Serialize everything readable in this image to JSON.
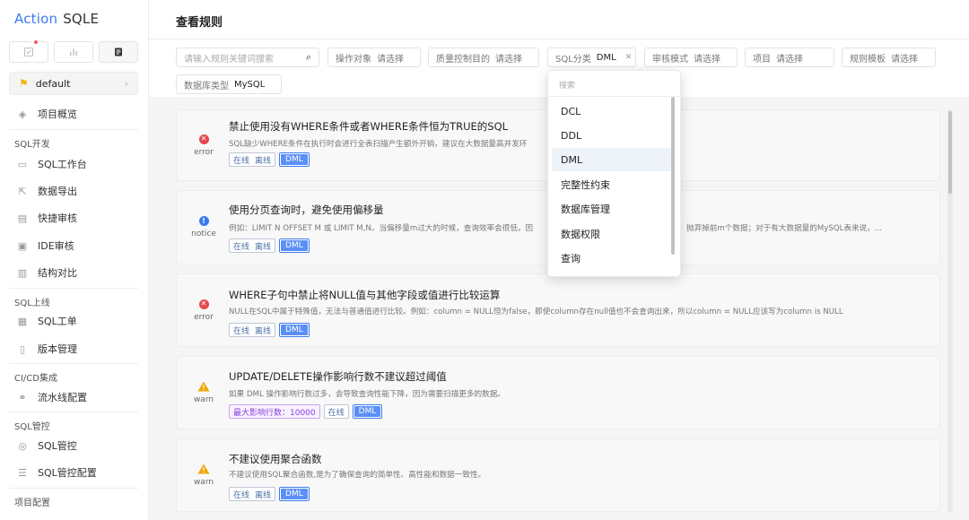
{
  "app": {
    "brand": "Action",
    "name": "SQLE"
  },
  "sidebar": {
    "project": "default",
    "overview": "项目概览",
    "groups": [
      {
        "title": "SQL开发",
        "items": [
          "SQL工作台",
          "数据导出",
          "快捷审核",
          "IDE审核",
          "结构对比"
        ]
      },
      {
        "title": "SQL上线",
        "items": [
          "SQL工单",
          "版本管理"
        ]
      },
      {
        "title": "CI/CD集成",
        "items": [
          "流水线配置"
        ]
      },
      {
        "title": "SQL管控",
        "items": [
          "SQL管控",
          "SQL管控配置"
        ]
      },
      {
        "title": "项目配置",
        "items": []
      }
    ]
  },
  "page": {
    "title": "查看规则"
  },
  "filters": {
    "search_placeholder": "请输入规则关键词搜索",
    "op_object": {
      "label": "操作对象",
      "placeholder": "请选择"
    },
    "quality": {
      "label": "质量控制目的",
      "placeholder": "请选择"
    },
    "sql_type": {
      "label": "SQL分类",
      "value": "DML"
    },
    "audit_mode": {
      "label": "审核模式",
      "placeholder": "请选择"
    },
    "project": {
      "label": "项目",
      "placeholder": "请选择"
    },
    "template": {
      "label": "规则模板",
      "placeholder": "请选择"
    },
    "db_type": {
      "label": "数据库类型",
      "value": "MySQL"
    }
  },
  "dropdown": {
    "search_placeholder": "搜索",
    "options": [
      "DCL",
      "DDL",
      "DML",
      "完整性约束",
      "数据库管理",
      "数据权限",
      "查询"
    ],
    "selected": "DML"
  },
  "rules": [
    {
      "level": "error",
      "title": "禁止使用没有WHERE条件或者WHERE条件恒为TRUE的SQL",
      "desc": "SQL缺少WHERE条件在执行时会进行全表扫描产生额外开销，建议在大数据量高并发环",
      "extra": "",
      "env": [
        "在线",
        "离线"
      ],
      "tag": "DML"
    },
    {
      "level": "notice",
      "title": "使用分页查询时，避免使用偏移量",
      "desc": "例如：LIMIT N OFFSET M 或 LIMIT M,N。当偏移量m过大的时候，查询效率会很低，因",
      "desc2": "抛弃掉前m个数据；对于有大数据量的MySQL表来说，...",
      "extra": "",
      "env": [
        "在线",
        "离线"
      ],
      "tag": "DML"
    },
    {
      "level": "error",
      "title": "WHERE子句中禁止将NULL值与其他字段或值进行比较运算",
      "desc": "NULL在SQL中属于特殊值，无法与普通值进行比较。例如：column = NULL恒为false，即使column存在null值也不会查询出来，所以column = NULL应该写为column is NULL",
      "extra": "",
      "env": [
        "在线",
        "离线"
      ],
      "tag": "DML"
    },
    {
      "level": "warn",
      "title": "UPDATE/DELETE操作影响行数不建议超过阈值",
      "desc": "如果 DML 操作影响行数过多，会导致查询性能下降，因为需要扫描更多的数据。",
      "extra": "最大影响行数：10000",
      "env": [
        "在线"
      ],
      "tag": "DML"
    },
    {
      "level": "warn",
      "title": "不建议使用聚合函数",
      "desc": "不建议使用SQL聚合函数,是为了确保查询的简单性、高性能和数据一致性。",
      "extra": "",
      "env": [
        "在线",
        "离线"
      ],
      "tag": "DML"
    }
  ],
  "colors": {
    "accent": "#3a7af0",
    "error": "#e5484d",
    "warn": "#f0a500",
    "purple": "#8b3fe0"
  }
}
